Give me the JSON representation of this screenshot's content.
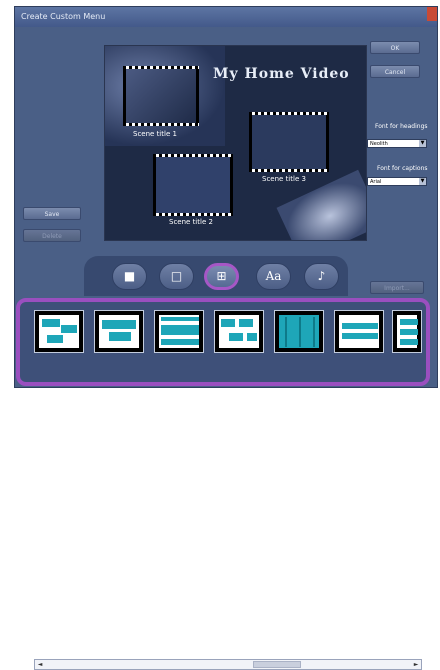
{
  "window": {
    "title": "Create Custom Menu"
  },
  "preview": {
    "title_art": "My Home Video",
    "scenes": [
      "Scene title 1",
      "Scene title 2",
      "Scene title 3"
    ]
  },
  "buttons": {
    "ok": "OK",
    "cancel": "Cancel",
    "save": "Save",
    "delete": "Delete",
    "import": "Import..."
  },
  "fonts": {
    "headings_label": "Font for headings",
    "headings_value": "Neolith",
    "captions_label": "Font for captions",
    "captions_value": "Arial"
  },
  "tabs": [
    {
      "icon": "square-filled-icon",
      "glyph": "■"
    },
    {
      "icon": "square-outline-icon",
      "glyph": "□"
    },
    {
      "icon": "grid-icon",
      "glyph": "⊞",
      "active": true
    },
    {
      "icon": "text-icon",
      "glyph": "Aa"
    },
    {
      "icon": "music-note-icon",
      "glyph": "♪"
    }
  ],
  "scrollbar": {
    "left_arrow": "◄",
    "right_arrow": "►"
  },
  "colors": {
    "window_bg": "#4a5f86",
    "highlight": "#9a4fbf",
    "thumb_accent": "#1ea6b8"
  }
}
